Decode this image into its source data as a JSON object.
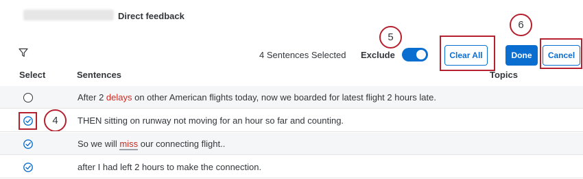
{
  "header": {
    "title": "Direct feedback"
  },
  "toolbar": {
    "selected_count": "4 Sentences Selected",
    "exclude_label": "Exclude",
    "exclude_on": true,
    "clear_all_label": "Clear All",
    "done_label": "Done",
    "cancel_label": "Cancel"
  },
  "table": {
    "columns": {
      "select": "Select",
      "sentences": "Sentences",
      "topics": "Topics"
    },
    "rows": [
      {
        "selected": false,
        "pre": "After 2 ",
        "mark": "delays",
        "post": " on other American flights today, now we boarded for latest flight 2 hours late."
      },
      {
        "selected": true,
        "text": "THEN sitting on runway not moving for an hour so far and counting."
      },
      {
        "selected": true,
        "pre": "So we will ",
        "mark": "miss",
        "post": " our connecting flight.."
      },
      {
        "selected": true,
        "text": "after I had left 2 hours to make the connection."
      }
    ]
  },
  "callouts": {
    "step4": "4",
    "step5": "5",
    "step6": "6"
  },
  "colors": {
    "accent": "#0a6ed1",
    "callout": "#b51f2e",
    "highlight_text": "#d0271d"
  }
}
